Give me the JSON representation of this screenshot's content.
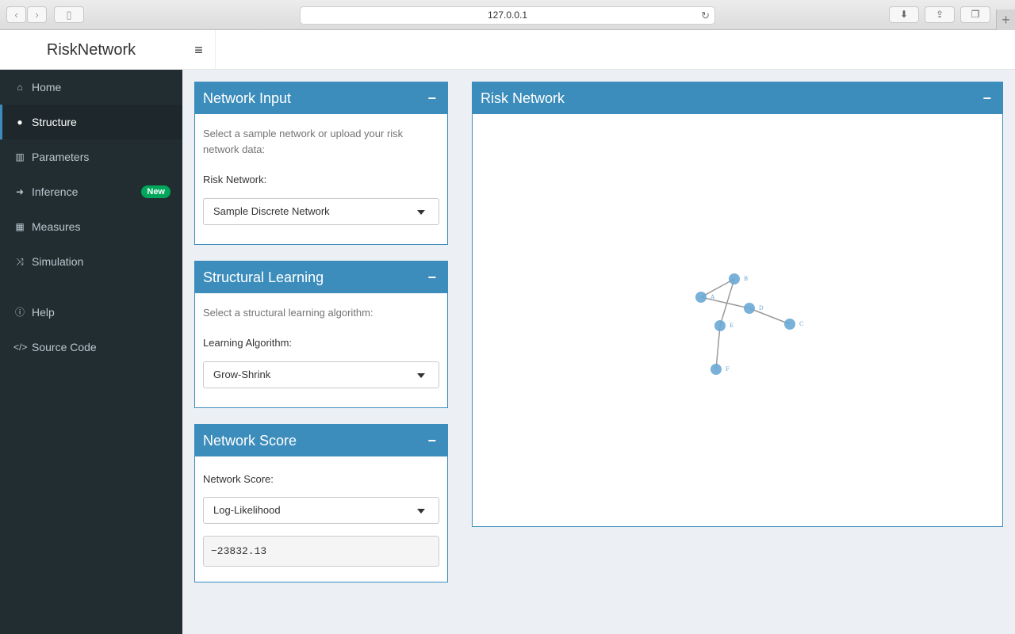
{
  "browser": {
    "url": "127.0.0.1"
  },
  "app": {
    "title": "RiskNetwork",
    "menu_icon": "bars-icon"
  },
  "sidebar": {
    "items": [
      {
        "label": "Home",
        "icon": "home-icon"
      },
      {
        "label": "Structure",
        "icon": "globe-icon",
        "active": true
      },
      {
        "label": "Parameters",
        "icon": "bar-chart-icon"
      },
      {
        "label": "Inference",
        "icon": "arrow-right-icon",
        "badge": "New"
      },
      {
        "label": "Measures",
        "icon": "table-icon"
      },
      {
        "label": "Simulation",
        "icon": "random-icon"
      },
      {
        "label": "Help",
        "icon": "info-circle-icon"
      },
      {
        "label": "Source Code",
        "icon": "code-icon"
      }
    ]
  },
  "network_input": {
    "title": "Network Input",
    "help": "Select a sample network or upload your risk network data:",
    "label": "Risk Network:",
    "selected": "Sample Discrete Network"
  },
  "structural_learning": {
    "title": "Structural Learning",
    "help": "Select a structural learning algorithm:",
    "label": "Learning Algorithm:",
    "selected": "Grow-Shrink"
  },
  "network_score": {
    "title": "Network Score",
    "label": "Network Score:",
    "selected": "Log-Likelihood",
    "value": "−23832.13"
  },
  "risk_network": {
    "title": "Risk Network",
    "nodes": [
      {
        "id": "A"
      },
      {
        "id": "B"
      },
      {
        "id": "C"
      },
      {
        "id": "D"
      },
      {
        "id": "E"
      },
      {
        "id": "F"
      }
    ],
    "edges": [
      {
        "from": "B",
        "to": "A"
      },
      {
        "from": "A",
        "to": "D"
      },
      {
        "from": "D",
        "to": "C"
      },
      {
        "from": "B",
        "to": "E"
      },
      {
        "from": "E",
        "to": "F"
      }
    ]
  },
  "colors": {
    "primary": "#3c8dbc",
    "sidebar_bg": "#222d32",
    "badge": "#00a65a",
    "node": "#6aa8d4"
  }
}
